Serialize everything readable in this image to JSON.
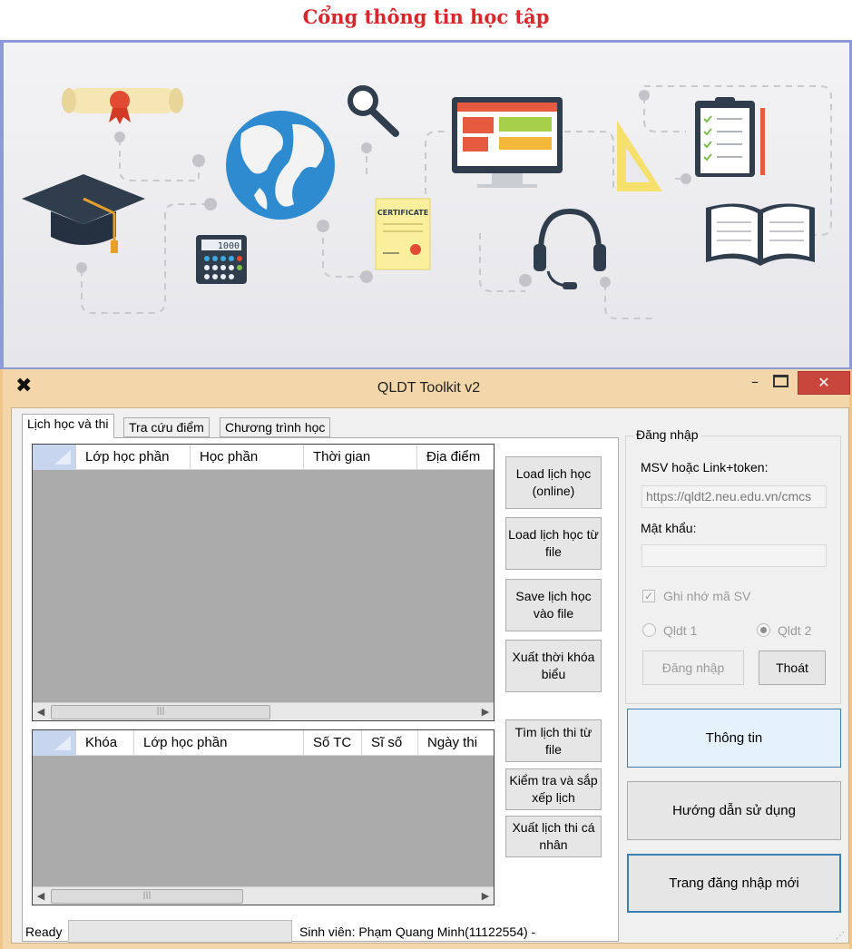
{
  "portal": {
    "title": "Cổng thông tin học tập",
    "banner": {
      "calculator_display": "1000",
      "certificate_label": "CERTIFICATE"
    }
  },
  "window": {
    "title": "QLDT Toolkit v2",
    "controls": {
      "minimize": "–",
      "close": "✕"
    }
  },
  "tabs": [
    {
      "label": "Lịch học và thi",
      "active": true
    },
    {
      "label": "Tra cứu điểm",
      "active": false
    },
    {
      "label": "Chương trình học",
      "active": false
    }
  ],
  "schedule_grid": {
    "columns": [
      "Lớp học phần",
      "Học phần",
      "Thời gian",
      "Địa điểm"
    ],
    "rows": []
  },
  "exam_grid": {
    "columns": [
      "Khóa",
      "Lớp học phần",
      "Số TC",
      "Sĩ số",
      "Ngày thi"
    ],
    "rows": []
  },
  "schedule_actions": [
    "Load lịch học (online)",
    "Load lịch học từ file",
    "Save lịch học vào file",
    "Xuất thời khóa biểu"
  ],
  "exam_actions": [
    "Tìm lịch thi từ file",
    "Kiểm tra và sắp xếp lịch",
    "Xuất lịch thi cá nhân"
  ],
  "login": {
    "group_title": "Đăng nhập",
    "msv_label": "MSV hoặc Link+token:",
    "msv_value": "https://qldt2.neu.edu.vn/cmcs",
    "password_label": "Mật khẩu:",
    "password_value": "",
    "remember_label": "Ghi nhớ mã SV",
    "remember_checked": true,
    "server_options": [
      "Qldt 1",
      "Qldt 2"
    ],
    "server_selected": "Qldt 2",
    "login_button": "Đăng nhập",
    "exit_button": "Thoát"
  },
  "side_buttons": [
    "Thông tin",
    "Hướng dẫn sử dụng",
    "Trang đăng nhập mới"
  ],
  "status": {
    "ready": "Ready",
    "student": "Sinh viên: Phạm Quang Minh(11122554)  -"
  },
  "colors": {
    "portal_title": "#d9262b",
    "window_frame": "#f3d6a9",
    "close_button": "#c9463d",
    "grid_background": "#ababab",
    "focus_blue": "#3c7fb1"
  }
}
